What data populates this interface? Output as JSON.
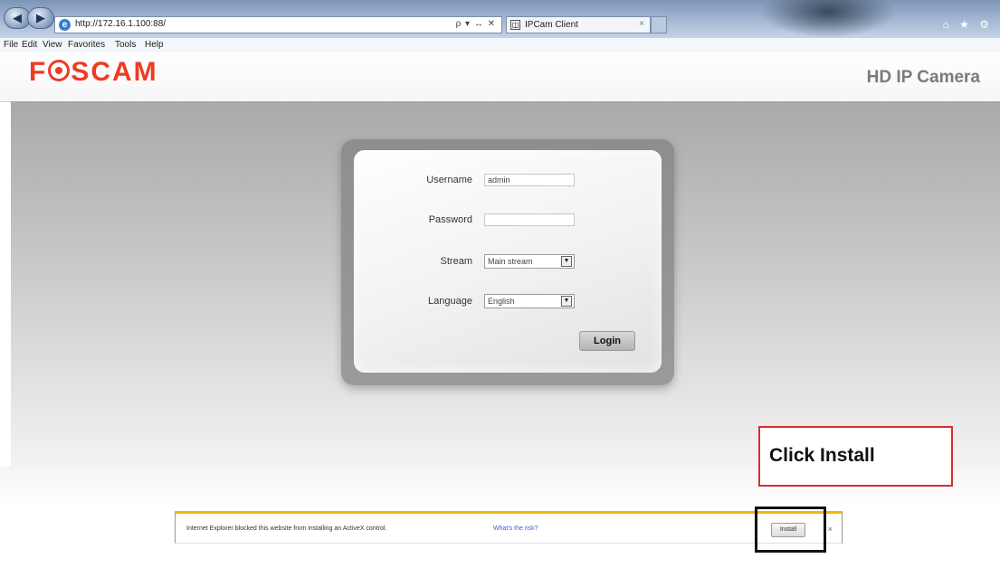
{
  "browser": {
    "address": "http://172.16.1.100:88/",
    "address_actions": "ρ ▾ ↔ ✕",
    "tab_title": "IPCam Client",
    "tab_close": "×",
    "back_icon": "back-icon",
    "forward_icon": "forward-icon",
    "right_icons": "⌂ ★ ⚙"
  },
  "menu": [
    "File",
    "Edit",
    "View",
    "Favorites",
    "Tools",
    "Help"
  ],
  "header": {
    "logo_parts": [
      "F",
      "SCAM"
    ],
    "product": "HD IP Camera",
    "brand_color": "#ee3b24"
  },
  "login": {
    "username_label": "Username",
    "username_value": "admin",
    "password_label": "Password",
    "password_value": "",
    "stream_label": "Stream",
    "stream_value": "Main stream",
    "language_label": "Language",
    "language_value": "English",
    "login_button": "Login"
  },
  "callout": {
    "text": "Click Install",
    "border_color": "#d32f2f"
  },
  "infobar": {
    "message": "Internet Explorer blocked this website from installing an ActiveX control.",
    "link": "What's the risk?",
    "install_button": "Install",
    "close": "×",
    "accent_color": "#f2b705"
  }
}
